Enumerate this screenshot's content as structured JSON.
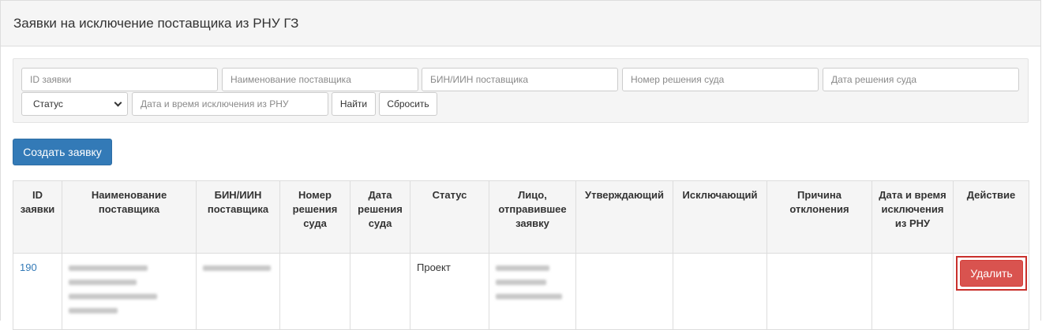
{
  "page": {
    "title": "Заявки на исключение поставщика из РНУ ГЗ"
  },
  "filters": {
    "id_placeholder": "ID заявки",
    "name_placeholder": "Наименование поставщика",
    "bin_placeholder": "БИН/ИИН поставщика",
    "court_number_placeholder": "Номер решения суда",
    "court_date_placeholder": "Дата решения суда",
    "status_value": "Статус",
    "exclusion_datetime_placeholder": "Дата и время исключения из РНУ",
    "find_label": "Найти",
    "reset_label": "Сбросить"
  },
  "actions": {
    "create_label": "Создать заявку"
  },
  "table": {
    "headers": [
      "ID заявки",
      "Наименование поставщика",
      "БИН/ИИН поставщика",
      "Номер решения суда",
      "Дата решения суда",
      "Статус",
      "Лицо, отправившее заявку",
      "Утверждающий",
      "Исключающий",
      "Причина отклонения",
      "Дата и время исключения из РНУ",
      "Действие"
    ],
    "rows": [
      {
        "id": "190",
        "status": "Проект",
        "action_label": "Удалить"
      }
    ]
  }
}
